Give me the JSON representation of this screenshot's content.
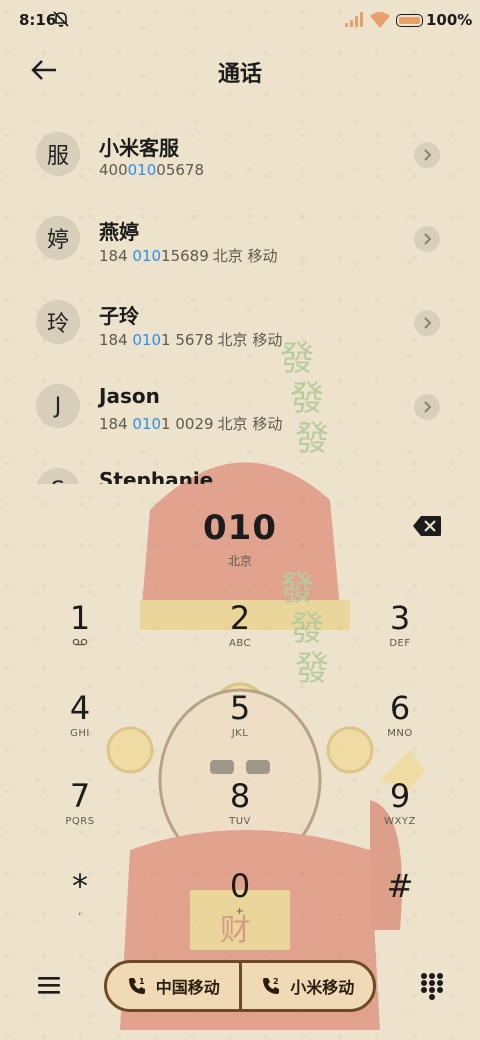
{
  "status": {
    "time": "8:16",
    "battery": "100%"
  },
  "header": {
    "title": "通话"
  },
  "contacts": [
    {
      "avatar": "服",
      "name": "小米客服",
      "pre": "400",
      "match": "010",
      "post": "05678",
      "location": ""
    },
    {
      "avatar": "婷",
      "name": "燕婷",
      "pre": "184 ",
      "match": "010",
      "post": "15689",
      "location": "北京 移动"
    },
    {
      "avatar": "玲",
      "name": "子玲",
      "pre": "184 ",
      "match": "010",
      "post": "1 5678",
      "location": "北京 移动"
    },
    {
      "avatar": "J",
      "name": "Jason",
      "pre": "184 ",
      "match": "010",
      "post": "1 0029",
      "location": "北京 移动"
    },
    {
      "avatar": "S",
      "name": "Stephanie",
      "pre": "",
      "match": "",
      "post": "",
      "location": ""
    }
  ],
  "dialer": {
    "number": "010",
    "location": "北京",
    "keys": [
      {
        "digit": "1",
        "letters": ""
      },
      {
        "digit": "2",
        "letters": "ABC"
      },
      {
        "digit": "3",
        "letters": "DEF"
      },
      {
        "digit": "4",
        "letters": "GHI"
      },
      {
        "digit": "5",
        "letters": "JKL"
      },
      {
        "digit": "6",
        "letters": "MNO"
      },
      {
        "digit": "7",
        "letters": "PQRS"
      },
      {
        "digit": "8",
        "letters": "TUV"
      },
      {
        "digit": "9",
        "letters": "WXYZ"
      },
      {
        "digit": "*",
        "letters": ","
      },
      {
        "digit": "0",
        "letters": "+"
      },
      {
        "digit": "#",
        "letters": ""
      }
    ]
  },
  "call_buttons": [
    {
      "sim": "1",
      "label": "中国移动"
    },
    {
      "sim": "2",
      "label": "小米移动"
    }
  ],
  "icons": {
    "back": "back-arrow-icon",
    "bell": "bell-muted-icon",
    "backspace": "backspace-icon",
    "menu": "menu-icon",
    "keypad": "keypad-icon",
    "voicemail": "voicemail-icon"
  },
  "colors": {
    "highlight": "#2e8ef0",
    "call_border": "#6b4a25",
    "call_fill": "#f0d9b5"
  }
}
